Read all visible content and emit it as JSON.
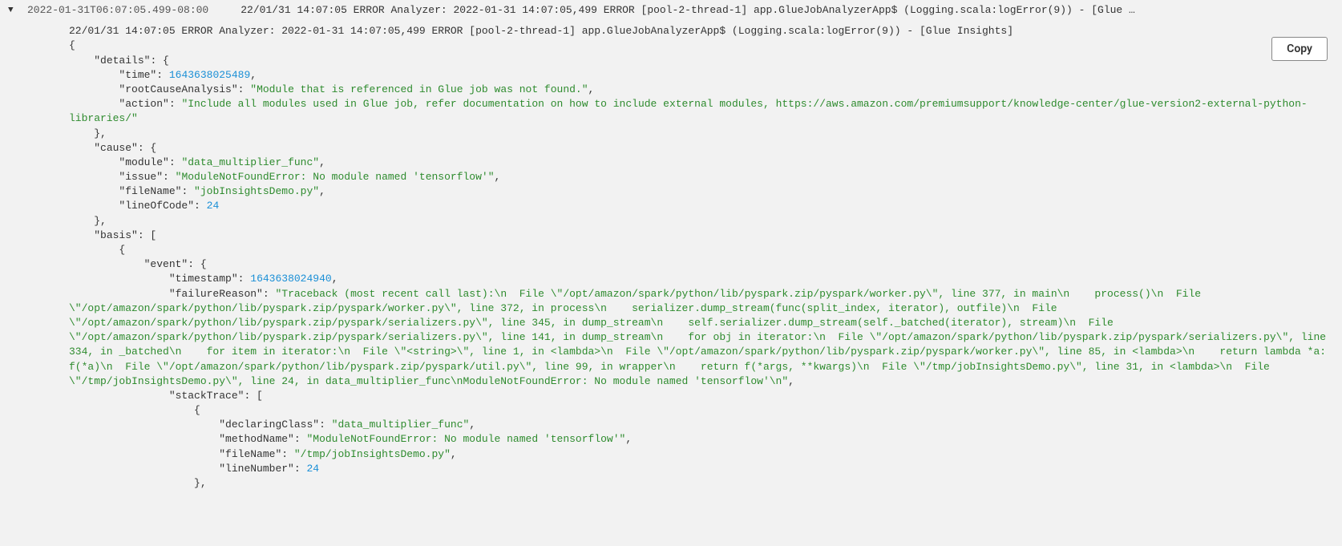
{
  "header": {
    "timestamp": "2022-01-31T06:07:05.499-08:00",
    "summary": "22/01/31 14:07:05 ERROR Analyzer: 2022-01-31 14:07:05,499 ERROR [pool-2-thread-1] app.GlueJobAnalyzerApp$ (Logging.scala:logError(9)) - [Glue …"
  },
  "expanded": {
    "firstLine": "22/01/31 14:07:05 ERROR Analyzer: 2022-01-31 14:07:05,499 ERROR [pool-2-thread-1] app.GlueJobAnalyzerApp$ (Logging.scala:logError(9)) - [Glue Insights]",
    "json": {
      "details": {
        "time": 1643638025489,
        "rootCauseAnalysis": "Module that is referenced in Glue job was not found.",
        "action": "Include all modules used in Glue job, refer documentation on how to include external modules, https://aws.amazon.com/premiumsupport/knowledge-center/glue-version2-external-python-libraries/"
      },
      "cause": {
        "module": "data_multiplier_func",
        "issue": "ModuleNotFoundError: No module named 'tensorflow'",
        "fileName": "jobInsightsDemo.py",
        "lineOfCode": 24
      },
      "basis": [
        {
          "event": {
            "timestamp": 1643638024940,
            "failureReason": "Traceback (most recent call last):\\n  File \\\"/opt/amazon/spark/python/lib/pyspark.zip/pyspark/worker.py\\\", line 377, in main\\n    process()\\n  File \\\"/opt/amazon/spark/python/lib/pyspark.zip/pyspark/worker.py\\\", line 372, in process\\n    serializer.dump_stream(func(split_index, iterator), outfile)\\n  File \\\"/opt/amazon/spark/python/lib/pyspark.zip/pyspark/serializers.py\\\", line 345, in dump_stream\\n    self.serializer.dump_stream(self._batched(iterator), stream)\\n  File \\\"/opt/amazon/spark/python/lib/pyspark.zip/pyspark/serializers.py\\\", line 141, in dump_stream\\n    for obj in iterator:\\n  File \\\"/opt/amazon/spark/python/lib/pyspark.zip/pyspark/serializers.py\\\", line 334, in _batched\\n    for item in iterator:\\n  File \\\"<string>\\\", line 1, in <lambda>\\n  File \\\"/opt/amazon/spark/python/lib/pyspark.zip/pyspark/worker.py\\\", line 85, in <lambda>\\n    return lambda *a: f(*a)\\n  File \\\"/opt/amazon/spark/python/lib/pyspark.zip/pyspark/util.py\\\", line 99, in wrapper\\n    return f(*args, **kwargs)\\n  File \\\"/tmp/jobInsightsDemo.py\\\", line 31, in <lambda>\\n  File \\\"/tmp/jobInsightsDemo.py\\\", line 24, in data_multiplier_func\\nModuleNotFoundError: No module named 'tensorflow'\\n",
            "stackTrace": [
              {
                "declaringClass": "data_multiplier_func",
                "methodName": "ModuleNotFoundError: No module named 'tensorflow'",
                "fileName": "/tmp/jobInsightsDemo.py",
                "lineNumber": 24
              }
            ]
          }
        }
      ]
    }
  },
  "buttons": {
    "copy": "Copy"
  }
}
